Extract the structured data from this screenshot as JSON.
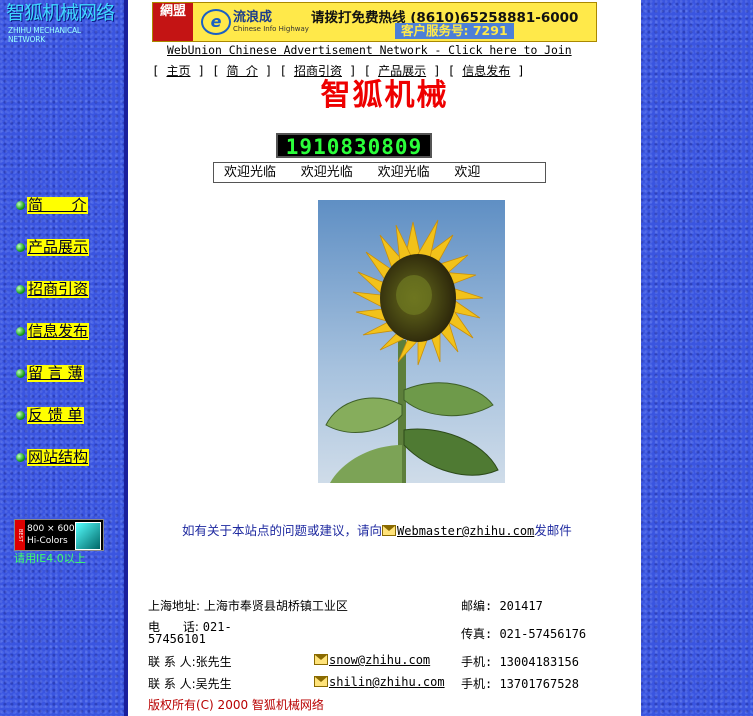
{
  "sidebar": {
    "logo_cn": "智狐机械网络",
    "logo_en": "ZHIHU MECHANICAL NETWORK",
    "items": [
      {
        "label": "简      介"
      },
      {
        "label": "产品展示"
      },
      {
        "label": "招商引资"
      },
      {
        "label": "信息发布"
      },
      {
        "label": "留 言 薄"
      },
      {
        "label": "反 馈 单"
      },
      {
        "label": "网站结构"
      }
    ],
    "res_badge_side": "BEST",
    "res_badge_line1": "800 × 600",
    "res_badge_line2": "Hi-Colors",
    "res_note": "请用IE4.0以上"
  },
  "banner": {
    "badge": "網盟",
    "icon": "e",
    "brand": "流浪成",
    "brand_en": "Chinese Info Highway",
    "hotline": "请拨打免费热线 (8610)65258881-6000",
    "service": "客户服务号: 7291"
  },
  "webunion": "WebUnion Chinese Advertisement Network - Click here to Join",
  "topnav": {
    "items": [
      "主页",
      "简 介",
      "招商引资",
      "产品展示",
      "信息发布"
    ]
  },
  "site_title": "智狐机械",
  "counter": "1910830809",
  "marquee": "欢迎光临      欢迎光临      欢迎光临      欢迎",
  "contact_note": {
    "prefix": "如有关于本站点的问题或建议，请向",
    "email": "Webmaster@zhihu.com",
    "suffix": "发邮件"
  },
  "contacts": {
    "address_label": "上海地址:",
    "address": "上海市奉贤县胡桥镇工业区",
    "postcode": "邮编: 201417",
    "phone_label": "电      话:",
    "phone": "021-",
    "phone2": "57456101",
    "fax": "传真: 021-57456176",
    "contact1": "联 系 人:张先生",
    "email1": "snow@zhihu.com",
    "mobile1": "手机: 13004183156",
    "contact2": "联 系 人:吴先生",
    "email2": "shilin@zhihu.com",
    "mobile2": "手机: 13701767528"
  },
  "copyright": "版权所有(C) 2000 智狐机械网络",
  "colors": {
    "sidebar_bg": "#3a55e0",
    "nav_highlight": "#ffff00",
    "title_red": "#ee0000",
    "counter_green": "#2bff3a"
  }
}
